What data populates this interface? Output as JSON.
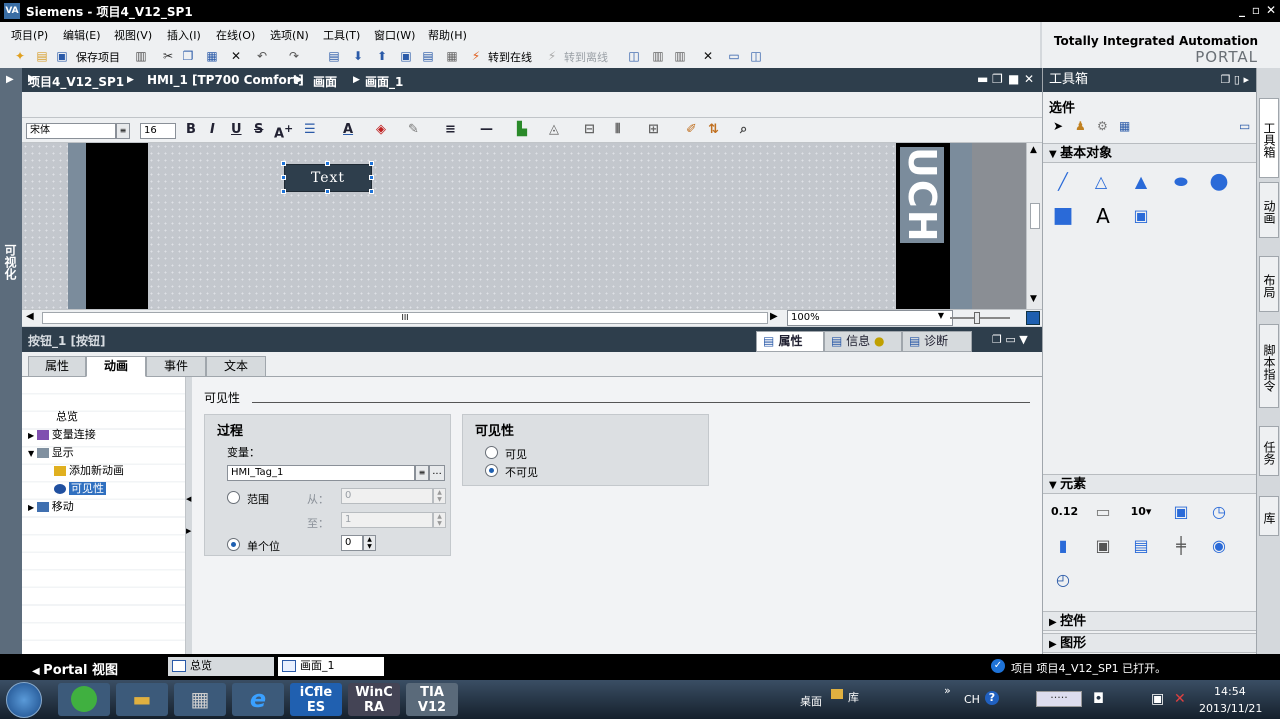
{
  "window": {
    "title": "Siemens  -  项目4_V12_SP1",
    "logo": "VA"
  },
  "menu": [
    "项目(P)",
    "编辑(E)",
    "视图(V)",
    "插入(I)",
    "在线(O)",
    "选项(N)",
    "工具(T)",
    "窗口(W)",
    "帮助(H)"
  ],
  "toolbar": {
    "save_label": "保存项目",
    "go_online": "转到在线",
    "go_offline": "转到离线"
  },
  "brand": {
    "line1": "Totally Integrated Automation",
    "line2": "PORTAL"
  },
  "left_strip": {
    "label": "可视化"
  },
  "breadcrumb": [
    "项目4_V12_SP1",
    "HMI_1 [TP700 Comfort]",
    "画面",
    "画面_1"
  ],
  "format": {
    "font": "宋体",
    "size": "16"
  },
  "canvas": {
    "button_text": "Text",
    "brand_vertical": "UCHI",
    "zoom": "100%"
  },
  "props": {
    "title": "按钮_1 [按钮]",
    "right_tabs": [
      "属性",
      "信息",
      "诊断"
    ],
    "sub_tabs": [
      "属性",
      "动画",
      "事件",
      "文本"
    ],
    "tree": [
      "总览",
      "变量连接",
      "显示",
      "添加新动画",
      "可见性",
      "移动"
    ],
    "section": "可见性",
    "process": {
      "title": "过程",
      "var_label": "变量：",
      "var_value": "HMI_Tag_1",
      "range_label": "范围",
      "from_label": "从：",
      "from_value": "0",
      "to_label": "至：",
      "to_value": "1",
      "single_label": "单个位",
      "single_value": "0"
    },
    "visibility": {
      "title": "可见性",
      "visible": "可见",
      "invisible": "不可见"
    }
  },
  "toolbox": {
    "title": "工具箱",
    "options": "选件",
    "basic": "基本对象",
    "elements": "元素",
    "controls": "控件",
    "graphics": "图形"
  },
  "right_tabs": [
    "工具箱",
    "动画",
    "布局",
    "脚本指令",
    "任务",
    "库"
  ],
  "portal": {
    "label": "Portal 视图",
    "tab1": "总览",
    "tab2": "画面_1",
    "status": "项目 项目4_V12_SP1 已打开。"
  },
  "taskbar": {
    "desktop": "桌面",
    "lib": "库",
    "lang": "CH",
    "time": "14:54",
    "date": "2013/11/21",
    "apps": [
      "iCfle ES",
      "WinC RA",
      "TIA V12"
    ]
  }
}
